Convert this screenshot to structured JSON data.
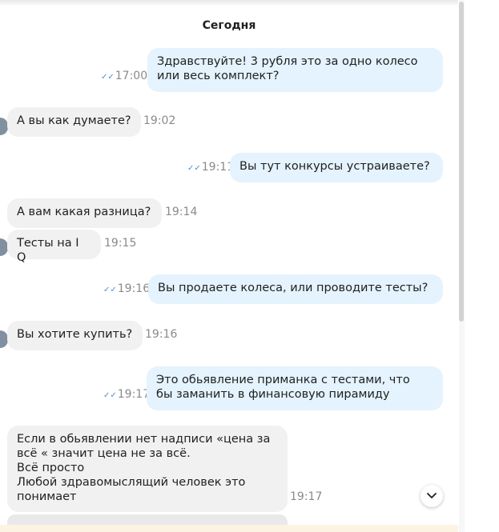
{
  "date_separator": "Сегодня",
  "messages": [
    {
      "dir": "out",
      "text": "Здравствуйте!  3 рубля это за одно колесо\nили весь комплект?",
      "time": "17:00"
    },
    {
      "dir": "in",
      "text": "А вы как думаете?",
      "time": "19:02"
    },
    {
      "dir": "out",
      "text": "Вы тут конкурсы устраиваете?",
      "time": "19:11"
    },
    {
      "dir": "in",
      "text": "А вам какая разница?",
      "time": "19:14"
    },
    {
      "dir": "in",
      "text": "Тесты на I Q",
      "time": "19:15"
    },
    {
      "dir": "out",
      "text": "Вы продаете колеса, или проводите тесты?",
      "time": "19:16"
    },
    {
      "dir": "in",
      "text": "Вы хотите купить?",
      "time": "19:16"
    },
    {
      "dir": "out",
      "text": "Это обьявление приманка с тестами, что\nбы заманить в финансовую пирамиду",
      "time": "19:17"
    },
    {
      "dir": "in",
      "text": "Если в обьявлении нет надписи «цена за\nвсё « значит цена не за всё.\nВсё просто\nЛюбой здравомыслящий человек это\nпонимает",
      "time": "19:17"
    }
  ],
  "icons": {
    "read_receipt": "double-check-icon",
    "scroll_down": "chevron-down-icon"
  },
  "colors": {
    "outgoing_bubble": "#e4f3fd",
    "incoming_bubble": "#f1f1f1",
    "read_tick": "#4d8bd6",
    "time_text": "#8a8a8a"
  }
}
